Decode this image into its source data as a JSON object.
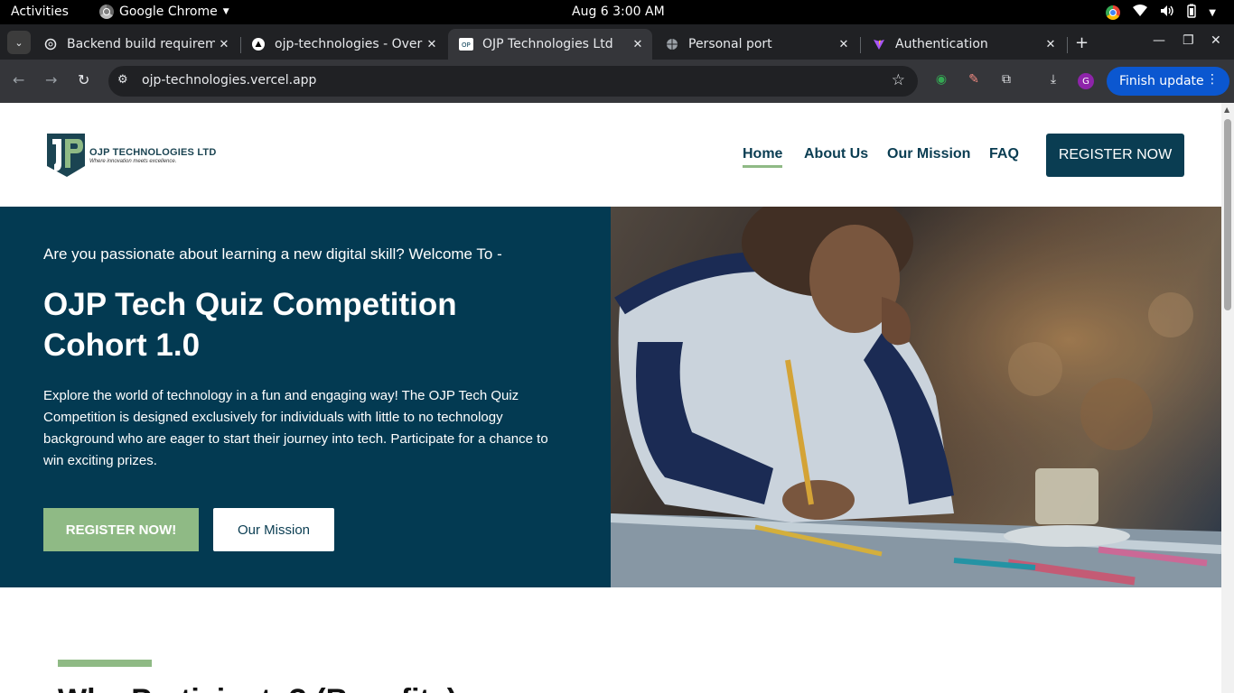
{
  "system": {
    "activities": "Activities",
    "app_name": "Google Chrome",
    "clock": "Aug 6   3:00 AM"
  },
  "tabs": [
    {
      "title": "Backend build requirem",
      "favicon": "openai-icon"
    },
    {
      "title": "ojp-technologies - Over",
      "favicon": "vercel-icon"
    },
    {
      "title": "OJP Technologies Ltd",
      "favicon": "ojp-icon",
      "active": true
    },
    {
      "title": "Personal port",
      "favicon": "globe-icon"
    },
    {
      "title": "Authentication",
      "favicon": "vite-icon"
    }
  ],
  "toolbar": {
    "url": "ojp-technologies.vercel.app",
    "profile_initial": "G",
    "finish_update": "Finish update"
  },
  "site": {
    "logo_name": "OJP TECHNOLOGIES LTD",
    "logo_tagline": "Where innovation meets excellence.",
    "nav": [
      "Home",
      "About Us",
      "Our Mission",
      "FAQ"
    ],
    "register_top": "REGISTER NOW"
  },
  "hero": {
    "kicker": "Are you passionate about learning a new digital skill? Welcome To -",
    "title": "OJP Tech Quiz Competition Cohort 1.0",
    "description": "Explore the world of technology in a fun and engaging way! The OJP Tech Quiz Competition is designed exclusively for individuals with little to no technology background who are eager to start their journey into tech. Participate for a chance to win exciting prizes.",
    "cta_primary": "REGISTER NOW!",
    "cta_secondary": "Our Mission"
  },
  "section2": {
    "heading": "Why Participate? (Benefits)"
  },
  "colors": {
    "brand_dark": "#033a52",
    "brand_green": "#8fba85",
    "chrome_blue": "#0b57d0"
  }
}
